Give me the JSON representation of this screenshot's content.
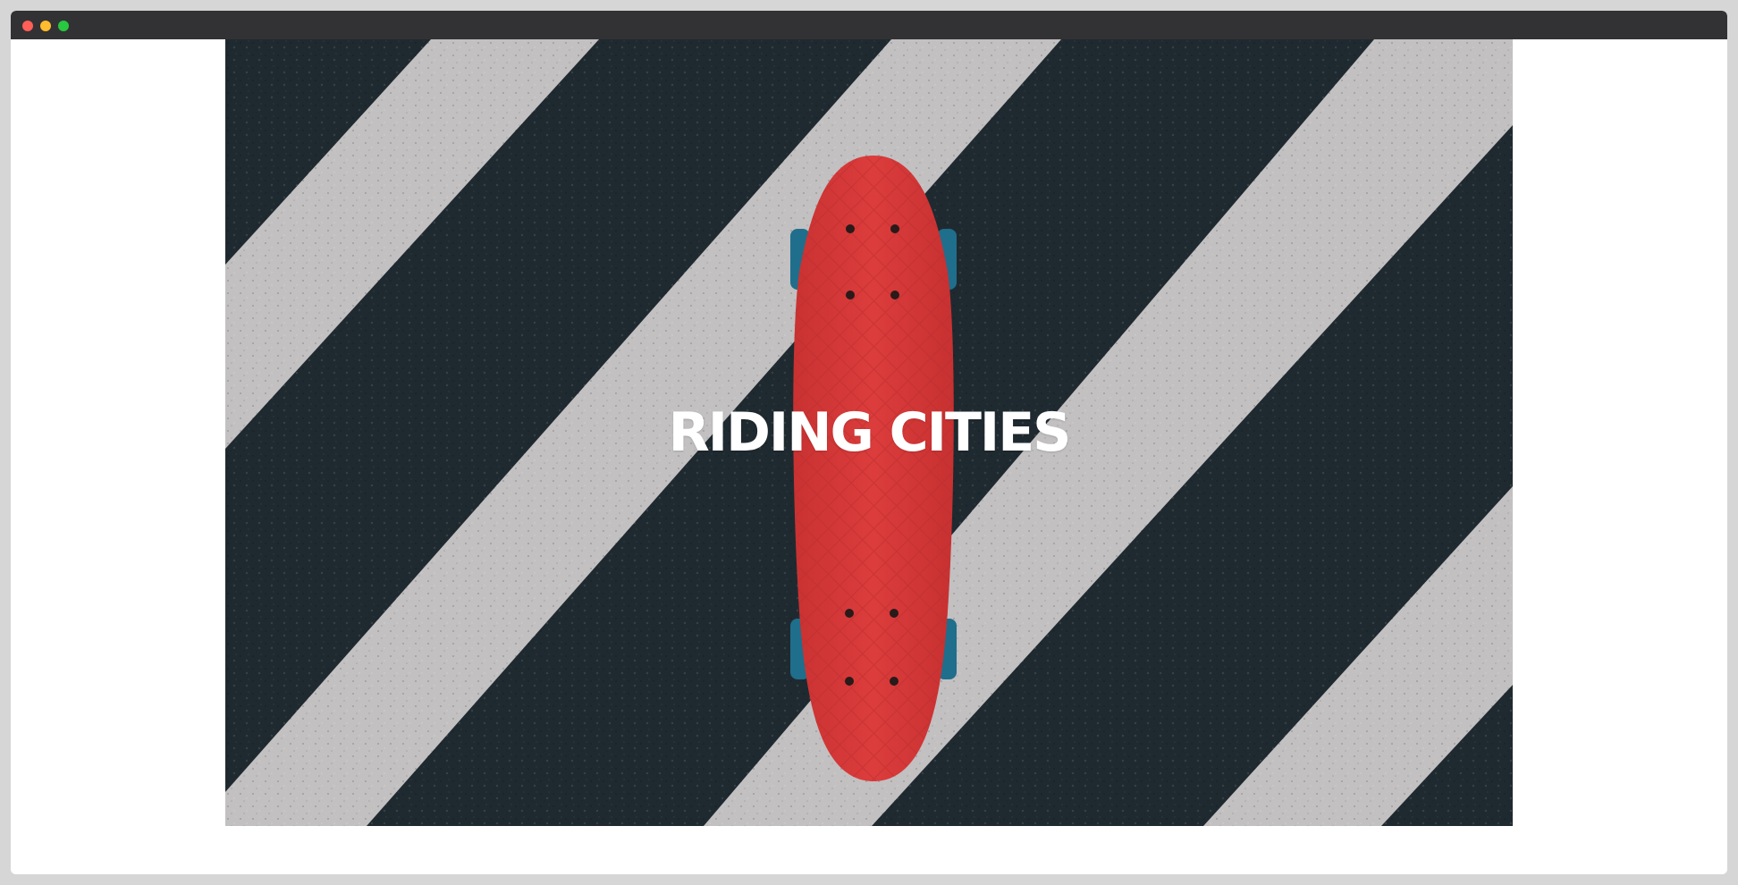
{
  "window": {
    "controls": [
      "close-button",
      "minimize-button",
      "maximize-button"
    ]
  },
  "hero": {
    "title": "RIDING CITIES",
    "image_subject": "red-skateboard-on-crosswalk",
    "colors": {
      "asphalt": "#1f2a30",
      "stripe": "#c2c0c1",
      "board": "#d73a3a",
      "wheels": "#1f6e8c",
      "title": "#ffffff"
    }
  }
}
